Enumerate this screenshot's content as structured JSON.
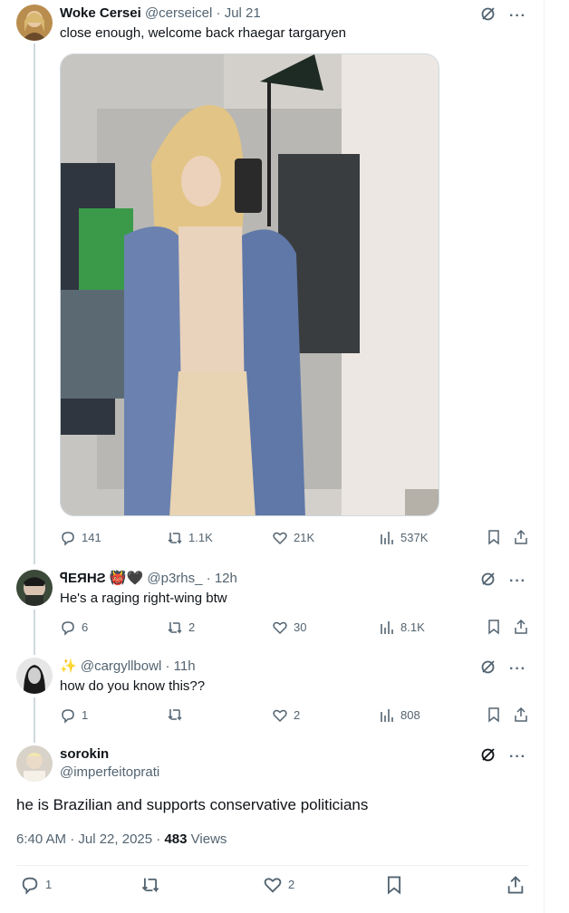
{
  "tweets": [
    {
      "name": "Woke Cersei",
      "handle": "@cerseicel",
      "time": "Jul 21",
      "text": "close enough, welcome back rhaegar targaryen",
      "replies": "141",
      "reposts": "1.1K",
      "likes": "21K",
      "views": "537K"
    },
    {
      "name": "SHRE",
      "name_prefix_glyph": "Ǝ",
      "name_display": "ꟼEЯHƧ",
      "emoji": "👹🖤",
      "handle": "@p3rhs_",
      "time": "12h",
      "text": "He's a raging right-wing btw",
      "replies": "6",
      "reposts": "2",
      "likes": "30",
      "views": "8.1K"
    },
    {
      "emoji": "✨",
      "handle": "@cargyllbowl",
      "time": "11h",
      "text": "how do you know this??",
      "replies": "1",
      "reposts": "",
      "likes": "2",
      "views": "808"
    }
  ],
  "main": {
    "name": "sorokin",
    "handle": "@imperfeitoprati",
    "text": "he is Brazilian and supports conservative politicians",
    "timestamp": "6:40 AM · Jul 22, 2025",
    "views_count": "483",
    "views_label": "Views",
    "replies": "1",
    "likes": "2"
  },
  "separator": "·",
  "more_label": "···",
  "colors": {
    "text_primary": "#0f1419",
    "text_secondary": "#536471",
    "divider": "#eff3f4",
    "thread_line": "#cfd9de"
  },
  "icons": [
    "grok-icon",
    "more-icon",
    "reply-icon",
    "repost-icon",
    "like-icon",
    "views-icon",
    "bookmark-icon",
    "share-icon"
  ]
}
